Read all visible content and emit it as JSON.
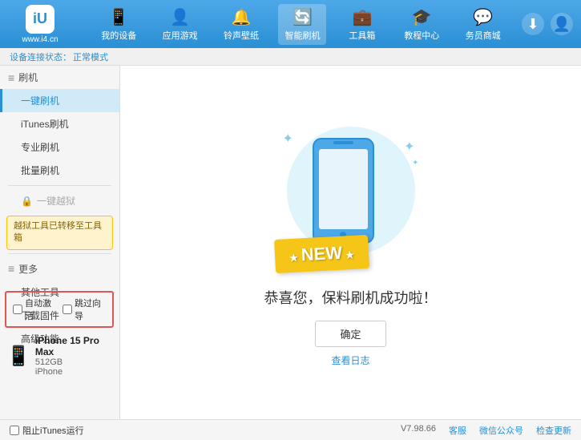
{
  "app": {
    "logo_label": "iU",
    "logo_url": "www.i4.cn"
  },
  "nav": {
    "items": [
      {
        "id": "my-device",
        "icon": "📱",
        "label": "我的设备"
      },
      {
        "id": "apps-games",
        "icon": "👤",
        "label": "应用游戏"
      },
      {
        "id": "ringtones",
        "icon": "🔔",
        "label": "铃声壁纸"
      },
      {
        "id": "smart-flash",
        "icon": "🔄",
        "label": "智能刷机",
        "active": true
      },
      {
        "id": "toolbox",
        "icon": "💼",
        "label": "工具箱"
      },
      {
        "id": "tutorial",
        "icon": "🎓",
        "label": "教程中心"
      },
      {
        "id": "business",
        "icon": "💬",
        "label": "务员商城"
      }
    ]
  },
  "breadcrumb": {
    "label": "设备连接状态：",
    "status": "正常模式"
  },
  "sidebar": {
    "flash_section": "刷机",
    "items": [
      {
        "id": "one-click-flash",
        "label": "一键刷机",
        "active": true
      },
      {
        "id": "itunes-flash",
        "label": "iTunes刷机"
      },
      {
        "id": "pro-flash",
        "label": "专业刷机"
      },
      {
        "id": "batch-flash",
        "label": "批量刷机"
      }
    ],
    "disabled_item": "一键越狱",
    "warning_text": "越狱工具已转移至工具箱",
    "more_section": "更多",
    "more_items": [
      {
        "id": "other-tools",
        "label": "其他工具"
      },
      {
        "id": "download-firmware",
        "label": "下载固件"
      },
      {
        "id": "advanced",
        "label": "高级功能"
      }
    ]
  },
  "auto_options": {
    "auto_activate": "自动激活",
    "auto_guide": "跳过向导"
  },
  "device": {
    "name": "iPhone 15 Pro Max",
    "storage": "512GB",
    "type": "iPhone"
  },
  "content": {
    "new_badge": "NEW",
    "success_message": "恭喜您，保料刷机成功啦！",
    "confirm_btn": "确定",
    "log_link": "查看日志"
  },
  "footer": {
    "itunes_label": "阻止iTunes运行",
    "version": "V7.98.66",
    "links": [
      "客服",
      "微信公众号",
      "检查更新"
    ]
  }
}
